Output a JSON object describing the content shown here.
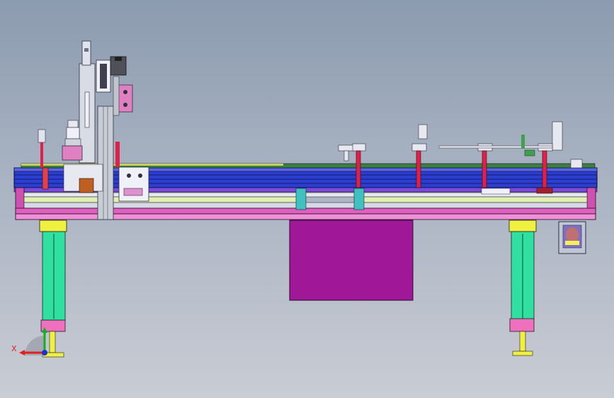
{
  "triad": {
    "x_label": "X",
    "x_color": "#e02020",
    "y_color": "#10b020",
    "z_color": "#2030d0"
  },
  "colors": {
    "background_top": "#8c9bb0",
    "background_bottom": "#c9ccd4",
    "rail_blue": "#2a3fd0",
    "rail_purple": "#7a4ad8",
    "frame_pink": "#e060c0",
    "cabinet_magenta": "#a01898",
    "leg_green": "#30e0a0",
    "leg_yellow": "#f0f040",
    "cylinder_red": "#e0204a",
    "column_gray": "#c8ccd4"
  },
  "icons": {
    "view_orientation": "coordinate-triad-icon",
    "operator_panel": "control-panel-icon"
  }
}
